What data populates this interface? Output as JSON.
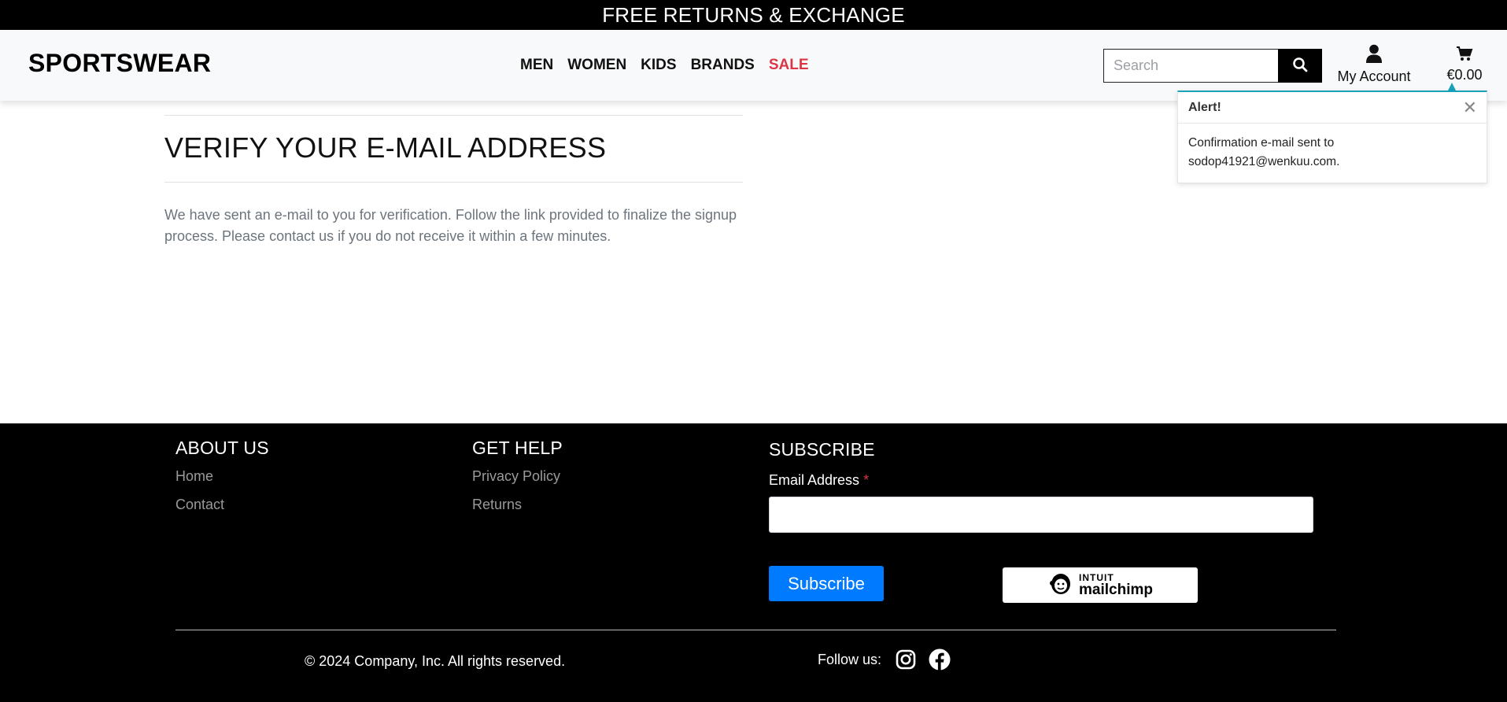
{
  "banner": {
    "text": "FREE RETURNS & EXCHANGE"
  },
  "header": {
    "logo": "SPORTSWEAR",
    "nav": [
      {
        "label": "MEN"
      },
      {
        "label": "WOMEN"
      },
      {
        "label": "KIDS"
      },
      {
        "label": "BRANDS"
      },
      {
        "label": "SALE"
      }
    ],
    "search": {
      "placeholder": "Search",
      "value": ""
    },
    "account_label": "My Account",
    "cart_total": "€0.00"
  },
  "alert": {
    "title": "Alert!",
    "message": "Confirmation e-mail sent to sodop41921@wenkuu.com."
  },
  "main": {
    "title": "VERIFY YOUR E-MAIL ADDRESS",
    "body": "We have sent an e-mail to you for verification. Follow the link provided to finalize the signup process. Please contact us if you do not receive it within a few minutes."
  },
  "footer": {
    "about": {
      "heading": "ABOUT US",
      "links": [
        "Home",
        "Contact"
      ]
    },
    "help": {
      "heading": "GET HELP",
      "links": [
        "Privacy Policy",
        "Returns"
      ]
    },
    "subscribe": {
      "heading": "SUBSCRIBE",
      "email_label": "Email Address",
      "required_mark": "*",
      "email_value": "",
      "button": "Subscribe",
      "badge_line1": "INTUIT",
      "badge_line2": "mailchimp"
    },
    "copyright": "© 2024 Company, Inc. All rights reserved.",
    "follow_label": "Follow us:",
    "social_icons": [
      "instagram-icon",
      "facebook-icon"
    ]
  },
  "colors": {
    "sale": "#dc3545",
    "primary_button": "#007bff",
    "alert_accent": "#17a2b8"
  }
}
